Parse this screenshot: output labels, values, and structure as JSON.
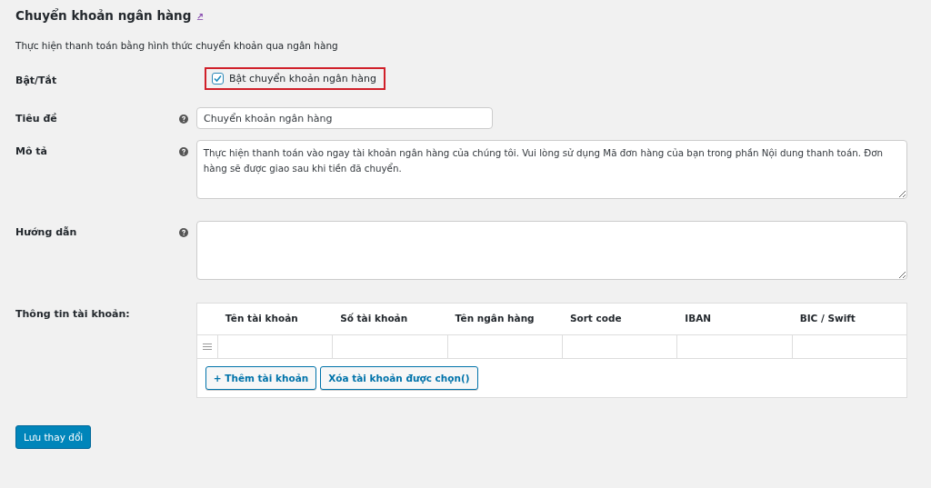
{
  "heading": {
    "title": "Chuyển khoản ngân hàng",
    "has_return_link": true
  },
  "description": "Thực hiện thanh toán bằng hình thức chuyển khoản qua ngân hàng",
  "fields": [
    {
      "kind": "checkbox",
      "label": "Bật/Tắt",
      "text": "Bật chuyển khoản ngân hàng",
      "checked": true,
      "highlighted": true,
      "help": false
    },
    {
      "kind": "text",
      "label": "Tiêu đề",
      "value": "Chuyển khoản ngân hàng",
      "help": true
    },
    {
      "kind": "textarea",
      "label": "Mô tả",
      "value": "Thực hiện thanh toán vào ngay tài khoản ngân hàng của chúng tôi. Vui lòng sử dụng Mã đơn hàng của bạn trong phần Nội dung thanh toán. Đơn hàng sẽ được giao sau khi tiền đã chuyển.",
      "help": true
    },
    {
      "kind": "textarea",
      "label": "Hướng dẫn",
      "help": true
    }
  ],
  "accounts": {
    "label": "Thông tin tài khoản:",
    "columns": [
      "Tên tài khoản",
      "Số tài khoản",
      "Tên ngân hàng",
      "Sort code",
      "IBAN",
      "BIC / Swift"
    ],
    "rows": [
      {
        "selected": false
      }
    ],
    "buttons": [
      "+ Thêm tài khoản",
      "Xóa tài khoản được chọn()"
    ]
  },
  "save_button": "Lưu thay đổi"
}
